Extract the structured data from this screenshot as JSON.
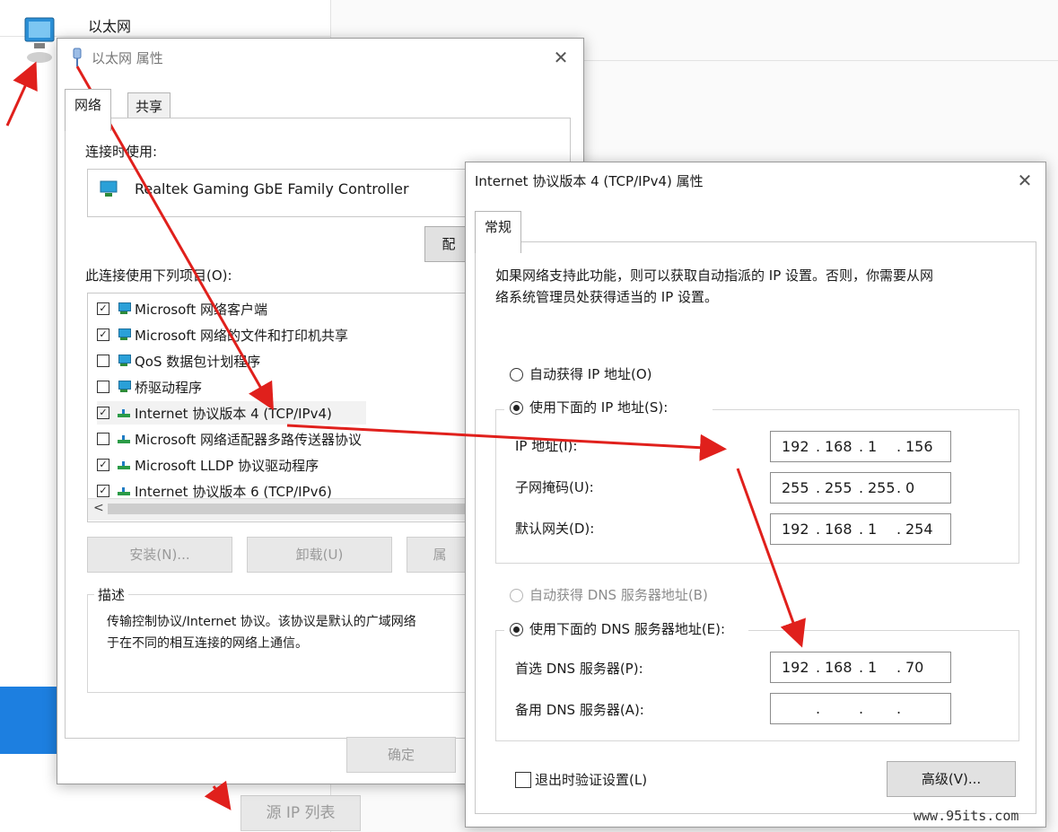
{
  "background": {
    "network_name": "以太网",
    "source_ip_button": "源 IP 列表"
  },
  "eth_dialog": {
    "title": "以太网 属性",
    "tabs": [
      "网络",
      "共享"
    ],
    "connect_using_label": "连接时使用:",
    "adapter_name": "Realtek Gaming GbE Family Controller",
    "configure_button": "配",
    "items_label": "此连接使用下列项目(O):",
    "items": [
      {
        "label": "Microsoft 网络客户端",
        "checked": true,
        "icon": "network-client-icon"
      },
      {
        "label": "Microsoft 网络的文件和打印机共享",
        "checked": true,
        "icon": "network-client-icon"
      },
      {
        "label": "QoS 数据包计划程序",
        "checked": false,
        "icon": "network-client-icon"
      },
      {
        "label": "桥驱动程序",
        "checked": false,
        "icon": "network-client-icon"
      },
      {
        "label": "Internet 协议版本 4 (TCP/IPv4)",
        "checked": true,
        "icon": "protocol-icon"
      },
      {
        "label": "Microsoft 网络适配器多路传送器协议",
        "checked": false,
        "icon": "protocol-icon"
      },
      {
        "label": "Microsoft LLDP 协议驱动程序",
        "checked": true,
        "icon": "protocol-icon"
      },
      {
        "label": "Internet 协议版本 6 (TCP/IPv6)",
        "checked": true,
        "icon": "protocol-icon"
      }
    ],
    "install_button": "安装(N)...",
    "uninstall_button": "卸载(U)",
    "properties_button": "属",
    "description_label": "描述",
    "description_line1": "传输控制协议/Internet 协议。该协议是默认的广域网络",
    "description_line2": "于在不同的相互连接的网络上通信。",
    "ok_button": "确定"
  },
  "ipv4_dialog": {
    "title": "Internet 协议版本 4 (TCP/IPv4) 属性",
    "tab": "常规",
    "intro_line1": "如果网络支持此功能，则可以获取自动指派的 IP 设置。否则，你需要从网",
    "intro_line2": "络系统管理员处获得适当的 IP 设置。",
    "auto_ip_label": "自动获得 IP 地址(O)",
    "manual_ip_label": "使用下面的 IP 地址(S):",
    "ip_label": "IP 地址(I):",
    "ip": [
      "192",
      "168",
      "1",
      "156"
    ],
    "mask_label": "子网掩码(U):",
    "mask": [
      "255",
      "255",
      "255",
      "0"
    ],
    "gateway_label": "默认网关(D):",
    "gateway": [
      "192",
      "168",
      "1",
      "254"
    ],
    "auto_dns_label": "自动获得 DNS 服务器地址(B)",
    "manual_dns_label": "使用下面的 DNS 服务器地址(E):",
    "preferred_dns_label": "首选 DNS 服务器(P):",
    "preferred_dns": [
      "192",
      "168",
      "1",
      "70"
    ],
    "alternate_dns_label": "备用 DNS 服务器(A):",
    "alternate_dns": [
      "",
      "",
      "",
      ""
    ],
    "validate_label": "退出时验证设置(L)",
    "advanced_button": "高级(V)..."
  },
  "watermark": "www.95its.com",
  "annotation_color": "#e0201c"
}
